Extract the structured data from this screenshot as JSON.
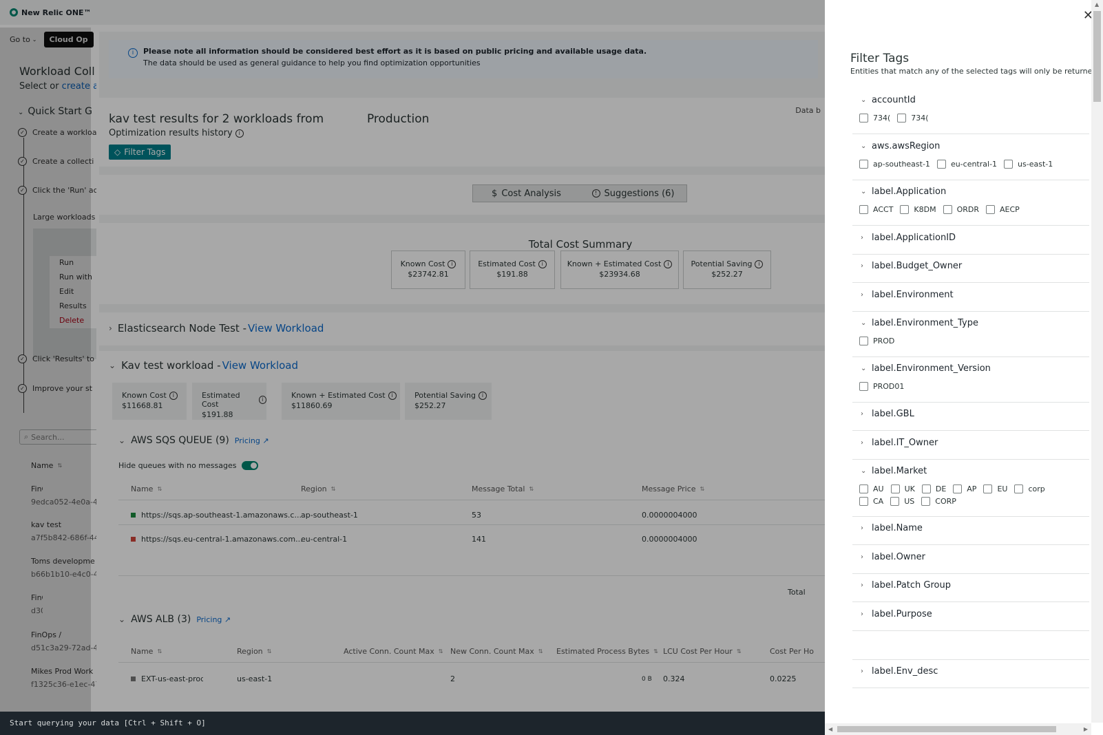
{
  "app": {
    "logo": "New Relic ONE™",
    "goto": "Go to",
    "cloud_btn": "Cloud Op"
  },
  "left_panel": {
    "title": "Workload Coll",
    "sub_prefix": "Select or ",
    "sub_link": "create a",
    "quick_start": "Quick Start G",
    "steps": [
      "Create a workloa",
      "Create a collecti",
      "Click the 'Run' ac",
      "Click 'Results' to",
      "Improve your st"
    ],
    "large": "Large workloads",
    "menu": [
      "Run",
      "Run with",
      "Edit",
      "Results",
      "Delete"
    ],
    "search_placeholder": "Search...",
    "name_col": "Name",
    "items": [
      {
        "name": "FinOps /",
        "sub": "9edca052-4e0a-4"
      },
      {
        "name": "kav test",
        "sub": "a7f5b842-686f-44"
      },
      {
        "name": "Toms developme",
        "sub": "b66b1b10-e4c0-4"
      },
      {
        "name": "FinOps /",
        "sub": "d30a483"
      },
      {
        "name": "FinOps /",
        "sub": "d51c3a29-72ad-4"
      },
      {
        "name": "Mikes Prod Work",
        "sub": "f1325c36-e1ec-47"
      }
    ]
  },
  "notice": {
    "line1": "Please note all information should be considered best effort as it is based on public pricing and available usage data.",
    "line2": "The data should be used as general guidance to help you find optimization opportunities"
  },
  "results": {
    "title_prefix": "kav test results for 2 workloads from",
    "title_suffix": "Production",
    "history": "Optimization results history",
    "filter_btn": "Filter Tags",
    "data_by": "Data b"
  },
  "tabs": {
    "cost": "Cost Analysis",
    "suggest": "Suggestions (6)"
  },
  "summary": {
    "title": "Total Cost Summary",
    "metrics": [
      {
        "label": "Known Cost",
        "value": "$23742.81"
      },
      {
        "label": "Estimated Cost",
        "value": "$191.88"
      },
      {
        "label": "Known + Estimated Cost",
        "value": "$23934.68"
      },
      {
        "label": "Potential Saving",
        "value": "$252.27"
      }
    ]
  },
  "workloads": [
    {
      "name": "Elasticsearch Node Test - ",
      "link": "View Workload"
    },
    {
      "name": "Kav test workload - ",
      "link": "View Workload"
    }
  ],
  "kav_metrics": [
    {
      "label": "Known Cost",
      "value": "$11668.81"
    },
    {
      "label": "Estimated Cost",
      "value": "$191.88"
    },
    {
      "label": "Known + Estimated Cost",
      "value": "$11860.69"
    },
    {
      "label": "Potential Saving",
      "value": "$252.27"
    }
  ],
  "sqs": {
    "title": "AWS SQS QUEUE (9)",
    "pricing": "Pricing",
    "toggle_label": "Hide queues with no messages",
    "cols": [
      "Name",
      "Region",
      "Message Total",
      "Message Price"
    ],
    "rows": [
      {
        "name": "https://sqs.ap-southeast-1.amazonaws.c...",
        "region": "ap-southeast-1",
        "total": "53",
        "price": "0.0000004000",
        "color": "#1c8a3f"
      },
      {
        "name": "https://sqs.eu-central-1.amazonaws.com...",
        "region": "eu-central-1",
        "total": "141",
        "price": "0.0000004000",
        "color": "#d0453a"
      }
    ],
    "total_label": "Total"
  },
  "alb": {
    "title": "AWS ALB (3)",
    "pricing": "Pricing",
    "cols": [
      "Name",
      "Region",
      "Active Conn. Count Max",
      "New Conn. Count Max",
      "Estimated Process Bytes",
      "LCU Cost Per Hour",
      "Cost Per Ho"
    ],
    "row": {
      "name": "EXT-us-east-prod-",
      "region": "us-east-1",
      "active": "",
      "new": "2",
      "bytes": "0 B",
      "lcu": "0.324",
      "cph": "0.0225",
      "color": "#777"
    }
  },
  "footer": "Start querying your data [Ctrl + Shift + O]",
  "drawer": {
    "title": "Filter Tags",
    "subtitle": "Entities that match any of the selected tags will only be returned.",
    "groups": [
      {
        "label": "accountId",
        "open": true,
        "options": [
          "734(",
          "734("
        ]
      },
      {
        "label": "aws.awsRegion",
        "open": true,
        "options": [
          "ap-southeast-1",
          "eu-central-1",
          "us-east-1"
        ]
      },
      {
        "label": "label.Application",
        "open": true,
        "options": [
          "ACCT",
          "K8DM",
          "ORDR",
          "AECP"
        ]
      },
      {
        "label": "label.ApplicationID",
        "open": false,
        "options": []
      },
      {
        "label": "label.Budget_Owner",
        "open": false,
        "options": []
      },
      {
        "label": "label.Environment",
        "open": false,
        "options": []
      },
      {
        "label": "label.Environment_Type",
        "open": true,
        "options": [
          "PROD"
        ]
      },
      {
        "label": "label.Environment_Version",
        "open": true,
        "options": [
          "PROD01"
        ]
      },
      {
        "label": "label.GBL",
        "open": false,
        "options": []
      },
      {
        "label": "label.IT_Owner",
        "open": false,
        "options": []
      },
      {
        "label": "label.Market",
        "open": true,
        "options": [
          "AU",
          "UK",
          "DE",
          "AP",
          "EU",
          "corp",
          "CA",
          "US",
          "CORP"
        ]
      },
      {
        "label": "label.Name",
        "open": false,
        "options": []
      },
      {
        "label": "label.Owner",
        "open": false,
        "options": []
      },
      {
        "label": "label.Patch Group",
        "open": false,
        "options": []
      },
      {
        "label": "label.Purpose",
        "open": false,
        "options": []
      },
      {
        "label": "",
        "open": false,
        "options": []
      },
      {
        "label": "label.Env_desc",
        "open": false,
        "options": []
      }
    ]
  }
}
